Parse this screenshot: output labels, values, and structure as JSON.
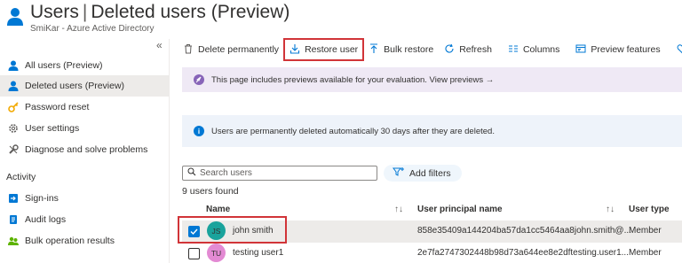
{
  "header": {
    "title": "Users",
    "separator": "|",
    "subtitle_title": "Deleted users (Preview)",
    "org": "SmiKar - Azure Active Directory"
  },
  "sidebar": {
    "collapse_glyph": "«",
    "items": [
      {
        "label": "All users (Preview)",
        "icon": "user-icon"
      },
      {
        "label": "Deleted users (Preview)",
        "icon": "user-icon",
        "selected": true
      },
      {
        "label": "Password reset",
        "icon": "key-icon"
      },
      {
        "label": "User settings",
        "icon": "gear-icon"
      },
      {
        "label": "Diagnose and solve problems",
        "icon": "wrench-icon"
      }
    ],
    "activity_label": "Activity",
    "activity_items": [
      {
        "label": "Sign-ins",
        "icon": "signin-icon"
      },
      {
        "label": "Audit logs",
        "icon": "log-icon"
      },
      {
        "label": "Bulk operation results",
        "icon": "people-icon"
      }
    ]
  },
  "toolbar": {
    "delete_label": "Delete permanently",
    "restore_label": "Restore user",
    "bulk_restore_label": "Bulk restore",
    "refresh_label": "Refresh",
    "columns_label": "Columns",
    "preview_label": "Preview features"
  },
  "banners": {
    "preview_text": "This page includes previews available for your evaluation. View previews →",
    "info_text": "Users are permanently deleted automatically 30 days after they are deleted."
  },
  "search": {
    "placeholder": "Search users"
  },
  "filter": {
    "label": "Add filters"
  },
  "count_text": "9 users found",
  "table": {
    "columns": {
      "name": "Name",
      "upn": "User principal name",
      "type": "User type"
    },
    "sort_glyph": "↑↓",
    "rows": [
      {
        "initials": "JS",
        "name": "john smith",
        "upn": "858e35409a144204ba57da1cc5464aa8john.smith@...",
        "type": "Member",
        "checked": true,
        "avatar_color": "#1aa39c"
      },
      {
        "initials": "TU",
        "name": "testing user1",
        "upn": "2e7fa2747302448b98d73a644ee8e2dftesting.user1...",
        "type": "Member",
        "checked": false,
        "avatar_color": "#e38ad3"
      }
    ]
  },
  "colors": {
    "accent": "#0078d4",
    "highlight": "#d13438"
  }
}
